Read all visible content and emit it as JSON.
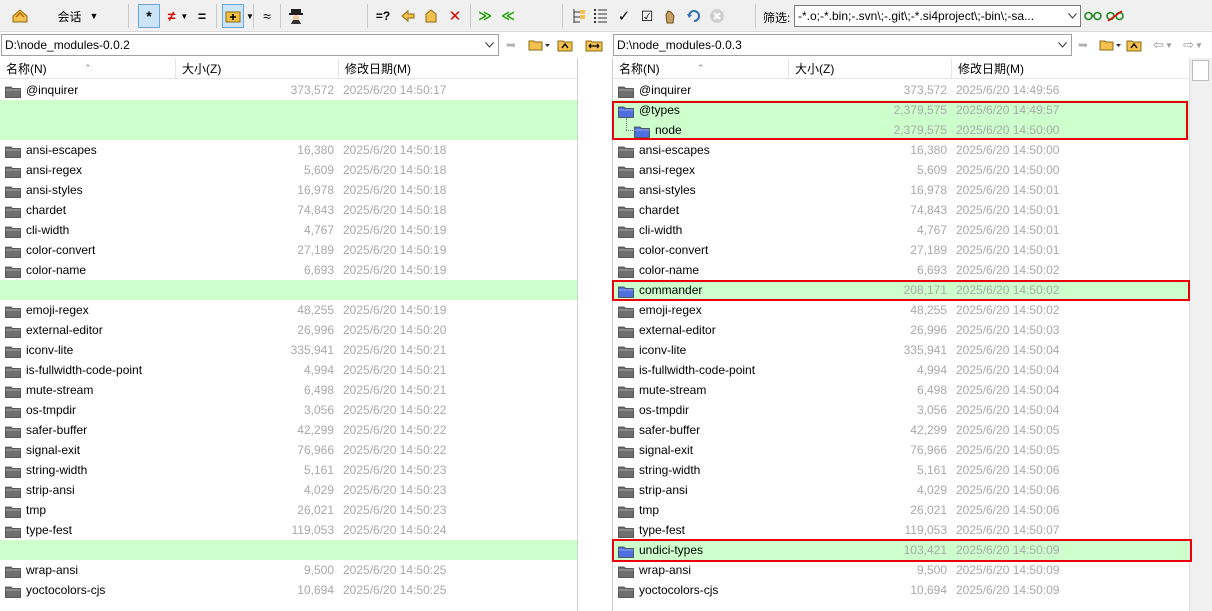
{
  "toolbar": {
    "session_label": "会话",
    "filter_label": "筛选:",
    "filter_value": "-*.o;-*.bin;-.svn\\;-.git\\;-*.si4project\\;-bin\\;-sa...",
    "icons": [
      "session-icon",
      "all-filter-icon",
      "not-equal-icon",
      "equal-icon",
      "expand-icon",
      "similar-icon",
      "spy-icon",
      "compare-icon",
      "prev-diff-icon",
      "home-icon",
      "stop-icon",
      "copy-right-icon",
      "copy-left-icon",
      "tree-icon",
      "list-icon",
      "check-icon",
      "check-all-icon",
      "touch-icon",
      "refresh-icon",
      "close-icon",
      "glasses-icon",
      "no-glasses-icon"
    ]
  },
  "left": {
    "path": "D:\\node_modules-0.0.2",
    "columns": {
      "name": "名称(N)",
      "size": "大小(Z)",
      "date": "修改日期(M)"
    },
    "rows": [
      {
        "name": "@inquirer",
        "size": "373,572",
        "date": "2025/6/20 14:50:17",
        "type": "folder"
      },
      {
        "name": "",
        "size": "",
        "date": "",
        "type": "blank"
      },
      {
        "name": "",
        "size": "",
        "date": "",
        "type": "blank"
      },
      {
        "name": "ansi-escapes",
        "size": "16,380",
        "date": "2025/6/20 14:50:18",
        "type": "folder"
      },
      {
        "name": "ansi-regex",
        "size": "5,609",
        "date": "2025/6/20 14:50:18",
        "type": "folder"
      },
      {
        "name": "ansi-styles",
        "size": "16,978",
        "date": "2025/6/20 14:50:18",
        "type": "folder"
      },
      {
        "name": "chardet",
        "size": "74,843",
        "date": "2025/6/20 14:50:18",
        "type": "folder"
      },
      {
        "name": "cli-width",
        "size": "4,767",
        "date": "2025/6/20 14:50:19",
        "type": "folder"
      },
      {
        "name": "color-convert",
        "size": "27,189",
        "date": "2025/6/20 14:50:19",
        "type": "folder"
      },
      {
        "name": "color-name",
        "size": "6,693",
        "date": "2025/6/20 14:50:19",
        "type": "folder"
      },
      {
        "name": "",
        "size": "",
        "date": "",
        "type": "blank"
      },
      {
        "name": "emoji-regex",
        "size": "48,255",
        "date": "2025/6/20 14:50:19",
        "type": "folder"
      },
      {
        "name": "external-editor",
        "size": "26,996",
        "date": "2025/6/20 14:50:20",
        "type": "folder"
      },
      {
        "name": "iconv-lite",
        "size": "335,941",
        "date": "2025/6/20 14:50:21",
        "type": "folder"
      },
      {
        "name": "is-fullwidth-code-point",
        "size": "4,994",
        "date": "2025/6/20 14:50:21",
        "type": "folder"
      },
      {
        "name": "mute-stream",
        "size": "6,498",
        "date": "2025/6/20 14:50:21",
        "type": "folder"
      },
      {
        "name": "os-tmpdir",
        "size": "3,056",
        "date": "2025/6/20 14:50:22",
        "type": "folder"
      },
      {
        "name": "safer-buffer",
        "size": "42,299",
        "date": "2025/6/20 14:50:22",
        "type": "folder"
      },
      {
        "name": "signal-exit",
        "size": "76,966",
        "date": "2025/6/20 14:50:22",
        "type": "folder"
      },
      {
        "name": "string-width",
        "size": "5,161",
        "date": "2025/6/20 14:50:23",
        "type": "folder"
      },
      {
        "name": "strip-ansi",
        "size": "4,029",
        "date": "2025/6/20 14:50:23",
        "type": "folder"
      },
      {
        "name": "tmp",
        "size": "26,021",
        "date": "2025/6/20 14:50:23",
        "type": "folder"
      },
      {
        "name": "type-fest",
        "size": "119,053",
        "date": "2025/6/20 14:50:24",
        "type": "folder"
      },
      {
        "name": "",
        "size": "",
        "date": "",
        "type": "blank"
      },
      {
        "name": "wrap-ansi",
        "size": "9,500",
        "date": "2025/6/20 14:50:25",
        "type": "folder"
      },
      {
        "name": "yoctocolors-cjs",
        "size": "10,694",
        "date": "2025/6/20 14:50:25",
        "type": "folder"
      }
    ]
  },
  "right": {
    "path": "D:\\node_modules-0.0.3",
    "columns": {
      "name": "名称(N)",
      "size": "大小(Z)",
      "date": "修改日期(M)"
    },
    "rows": [
      {
        "name": "@inquirer",
        "size": "373,572",
        "date": "2025/6/20 14:49:56",
        "type": "folder"
      },
      {
        "name": "@types",
        "size": "2,379,575",
        "date": "2025/6/20 14:49:57",
        "type": "new-folder"
      },
      {
        "name": "node",
        "size": "2,379,575",
        "date": "2025/6/20 14:50:00",
        "type": "new-subfolder"
      },
      {
        "name": "ansi-escapes",
        "size": "16,380",
        "date": "2025/6/20 14:50:00",
        "type": "folder"
      },
      {
        "name": "ansi-regex",
        "size": "5,609",
        "date": "2025/6/20 14:50:00",
        "type": "folder"
      },
      {
        "name": "ansi-styles",
        "size": "16,978",
        "date": "2025/6/20 14:50:01",
        "type": "folder"
      },
      {
        "name": "chardet",
        "size": "74,843",
        "date": "2025/6/20 14:50:01",
        "type": "folder"
      },
      {
        "name": "cli-width",
        "size": "4,767",
        "date": "2025/6/20 14:50:01",
        "type": "folder"
      },
      {
        "name": "color-convert",
        "size": "27,189",
        "date": "2025/6/20 14:50:01",
        "type": "folder"
      },
      {
        "name": "color-name",
        "size": "6,693",
        "date": "2025/6/20 14:50:02",
        "type": "folder"
      },
      {
        "name": "commander",
        "size": "208,171",
        "date": "2025/6/20 14:50:02",
        "type": "new-folder"
      },
      {
        "name": "emoji-regex",
        "size": "48,255",
        "date": "2025/6/20 14:50:02",
        "type": "folder"
      },
      {
        "name": "external-editor",
        "size": "26,996",
        "date": "2025/6/20 14:50:03",
        "type": "folder"
      },
      {
        "name": "iconv-lite",
        "size": "335,941",
        "date": "2025/6/20 14:50:04",
        "type": "folder"
      },
      {
        "name": "is-fullwidth-code-point",
        "size": "4,994",
        "date": "2025/6/20 14:50:04",
        "type": "folder"
      },
      {
        "name": "mute-stream",
        "size": "6,498",
        "date": "2025/6/20 14:50:04",
        "type": "folder"
      },
      {
        "name": "os-tmpdir",
        "size": "3,056",
        "date": "2025/6/20 14:50:04",
        "type": "folder"
      },
      {
        "name": "safer-buffer",
        "size": "42,299",
        "date": "2025/6/20 14:50:05",
        "type": "folder"
      },
      {
        "name": "signal-exit",
        "size": "76,966",
        "date": "2025/6/20 14:50:05",
        "type": "folder"
      },
      {
        "name": "string-width",
        "size": "5,161",
        "date": "2025/6/20 14:50:06",
        "type": "folder"
      },
      {
        "name": "strip-ansi",
        "size": "4,029",
        "date": "2025/6/20 14:50:06",
        "type": "folder"
      },
      {
        "name": "tmp",
        "size": "26,021",
        "date": "2025/6/20 14:50:06",
        "type": "folder"
      },
      {
        "name": "type-fest",
        "size": "119,053",
        "date": "2025/6/20 14:50:07",
        "type": "folder"
      },
      {
        "name": "undici-types",
        "size": "103,421",
        "date": "2025/6/20 14:50:09",
        "type": "new-folder"
      },
      {
        "name": "wrap-ansi",
        "size": "9,500",
        "date": "2025/6/20 14:50:09",
        "type": "folder"
      },
      {
        "name": "yoctocolors-cjs",
        "size": "10,694",
        "date": "2025/6/20 14:50:09",
        "type": "folder"
      }
    ]
  },
  "colors": {
    "diff_row_bg": "#ccffcc",
    "highlight_border": "#e8000b",
    "folder_normal": "#6e6e6e",
    "folder_new": "#4d6fe0",
    "muted_text": "#a8a8a8"
  }
}
